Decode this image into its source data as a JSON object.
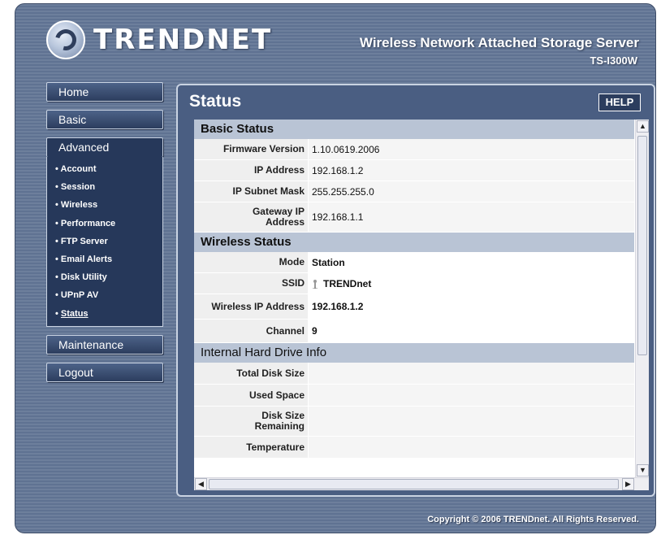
{
  "header": {
    "brand": "TRENDNET",
    "product_title": "Wireless Network Attached Storage Server",
    "model": "TS-I300W"
  },
  "nav": {
    "home": "Home",
    "basic": "Basic",
    "advanced": "Advanced",
    "advanced_items": [
      "Account",
      "Session",
      "Wireless",
      "Performance",
      "FTP Server",
      "Email Alerts",
      "Disk Utility",
      "UPnP AV",
      "Status"
    ],
    "maintenance": "Maintenance",
    "logout": "Logout"
  },
  "page": {
    "title": "Status",
    "help_label": "HELP"
  },
  "basic_status": {
    "heading": "Basic Status",
    "rows": [
      {
        "label": "Firmware Version",
        "value": "1.10.0619.2006"
      },
      {
        "label": "IP Address",
        "value": "192.168.1.2"
      },
      {
        "label": "IP Subnet Mask",
        "value": "255.255.255.0"
      },
      {
        "label": "Gateway IP Address",
        "value": "192.168.1.1"
      }
    ]
  },
  "wireless_status": {
    "heading": "Wireless Status",
    "rows": [
      {
        "label": "Mode",
        "value": "Station"
      },
      {
        "label": "SSID",
        "value": "TRENDnet"
      },
      {
        "label": "Wireless IP Address",
        "value": "192.168.1.2"
      },
      {
        "label": "Channel",
        "value": "9"
      }
    ]
  },
  "drive_info": {
    "heading": "Internal Hard Drive Info",
    "rows": [
      {
        "label": "Total Disk Size",
        "value": ""
      },
      {
        "label": "Used Space",
        "value": ""
      },
      {
        "label": "Disk Size Remaining",
        "value": ""
      },
      {
        "label": "Temperature",
        "value": ""
      }
    ]
  },
  "scrollbar": {
    "up_glyph": "▲",
    "down_glyph": "▼",
    "left_glyph": "◀",
    "right_glyph": "▶"
  },
  "footer": {
    "copyright": "Copyright © 2006 TRENDnet. All Rights Reserved."
  },
  "icons": {
    "ssid": "antenna-icon",
    "logo": "trendnet-logo-icon"
  }
}
